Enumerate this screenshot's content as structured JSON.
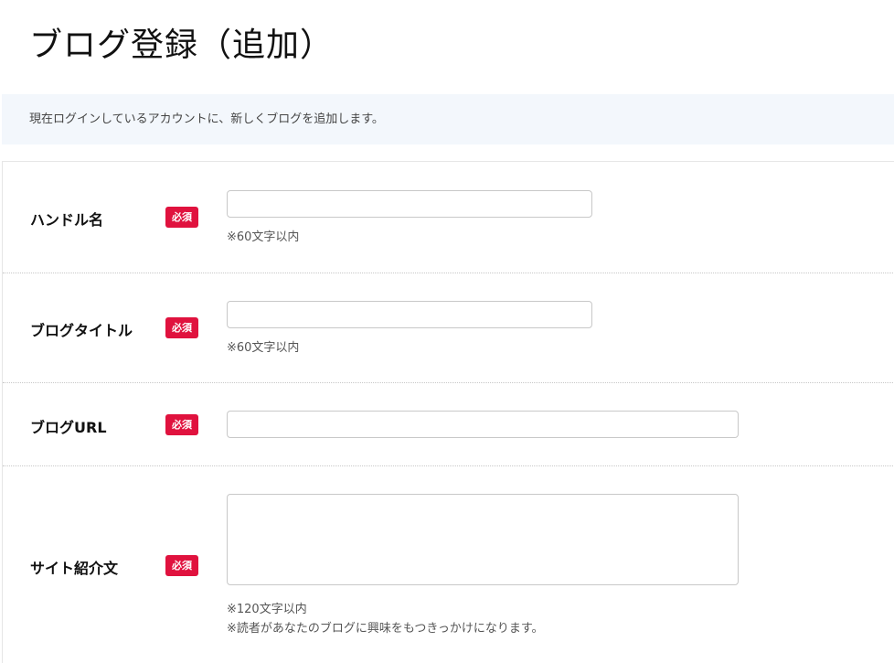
{
  "page": {
    "title": "ブログ登録（追加）",
    "banner": "現在ログインしているアカウントに、新しくブログを追加します。"
  },
  "form": {
    "required_label": "必須",
    "fields": [
      {
        "label": "ハンドル名",
        "value": "",
        "hints": [
          "※60文字以内"
        ]
      },
      {
        "label": "ブログタイトル",
        "value": "",
        "hints": [
          "※60文字以内"
        ]
      },
      {
        "label": "ブログURL",
        "value": "",
        "hints": []
      },
      {
        "label": "サイト紹介文",
        "value": "",
        "hints": [
          "※120文字以内",
          "※読者があなたのブログに興味をもつきっかけになります。"
        ]
      }
    ]
  },
  "colors": {
    "required_badge": "#e0123e",
    "banner_background": "#f3f7fc"
  }
}
